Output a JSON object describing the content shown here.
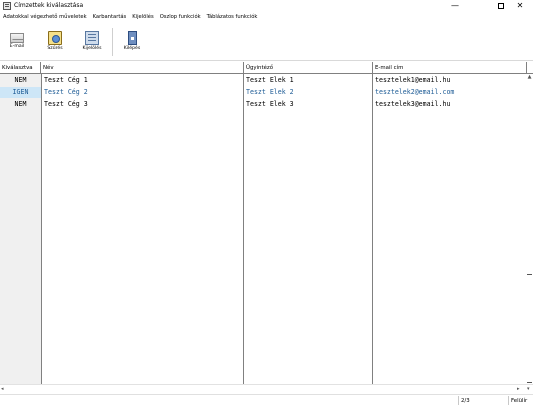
{
  "window": {
    "title": "Címzettek kiválasztása",
    "min_glyph": "—",
    "close_glyph": "✕"
  },
  "menu": [
    "Adatokkal végezhető műveletek",
    "Karbantartás",
    "Kijelölés",
    "Oszlop funkciók",
    "Táblázatos funkciók"
  ],
  "toolbar": {
    "email_label": "E-mail",
    "filter_label": "Szűrés",
    "select_label": "Kijelölés",
    "exit_label": "Kilépés"
  },
  "table": {
    "headers": {
      "selected": "Kiválasztva",
      "name": "Név",
      "contact": "Ügyintéző",
      "email": "E-mail cím"
    },
    "rows": [
      {
        "selected": "NEM",
        "name": "Teszt Cég 1",
        "contact": "Teszt Elek 1",
        "email": "tesztelek1@email.hu",
        "highlighted": false
      },
      {
        "selected": "IGEN",
        "name": "Teszt Cég 2",
        "contact": "Teszt Elek 2",
        "email": "tesztelek2@email.com",
        "highlighted": true
      },
      {
        "selected": "NEM",
        "name": "Teszt Cég 3",
        "contact": "Teszt Elek 3",
        "email": "tesztelek3@email.hu",
        "highlighted": false
      }
    ]
  },
  "scroll": {
    "up_glyph": "▲",
    "left_glyph": "◂",
    "right_glyph": "▸",
    "down_glyph": "▾"
  },
  "status": {
    "position": "2/3",
    "mode": "Felülír"
  },
  "colors": {
    "highlight_text": "#1e5c96",
    "selected_cell_bg": "#cde6f7"
  }
}
